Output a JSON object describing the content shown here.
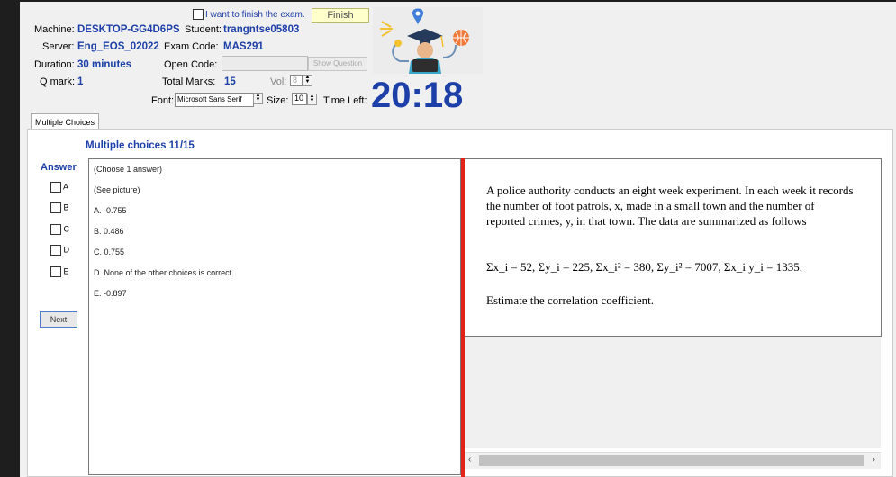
{
  "header": {
    "finish_checkbox_label": "I want to finish the exam.",
    "finish_button": "Finish",
    "machine_label": "Machine:",
    "machine_value": "DESKTOP-GG4D6PS",
    "student_label": "Student:",
    "student_value": "trangntse05803",
    "server_label": "Server:",
    "server_value": "Eng_EOS_02022",
    "exam_code_label": "Exam Code:",
    "exam_code_value": "MAS291",
    "duration_label": "Duration:",
    "duration_value": "30 minutes",
    "open_code_label": "Open Code:",
    "show_question_button": "Show Question",
    "qmark_label": "Q mark:",
    "qmark_value": "1",
    "total_marks_label": "Total Marks:",
    "total_marks_value": "15",
    "vol_label": "Vol:",
    "vol_value": "8",
    "font_label": "Font:",
    "font_value": "Microsoft Sans Serif",
    "size_label": "Size:",
    "size_value": "10",
    "time_left_label": "Time Left:",
    "timer": "20:18"
  },
  "tabs": [
    {
      "label": "Multiple Choices"
    }
  ],
  "question_panel": {
    "title": "Multiple choices 11/15",
    "answer_label": "Answer",
    "checkboxes": [
      "A",
      "B",
      "C",
      "D",
      "E"
    ],
    "next_button": "Next",
    "answer_lines": [
      "(Choose 1 answer)",
      "(See picture)",
      "A. -0.755",
      "B. 0.486",
      "C. 0.755",
      "D. None of the other choices is correct",
      "E. -0.897"
    ]
  },
  "question": {
    "text": "A police authority conducts an eight week experiment. In each week it records the number of foot patrols, x, made in a small town and the number of reported crimes, y, in that town. The data are summarized as follows",
    "formula": "Σx_i = 52, Σy_i = 225, Σx_i² = 380, Σy_i² = 7007, Σx_i y_i = 1335.",
    "estimate": "Estimate the correlation coefficient."
  },
  "colors": {
    "accent": "#1d3fa8",
    "divider": "#e2231a",
    "finish_bg": "#ffffcc"
  }
}
